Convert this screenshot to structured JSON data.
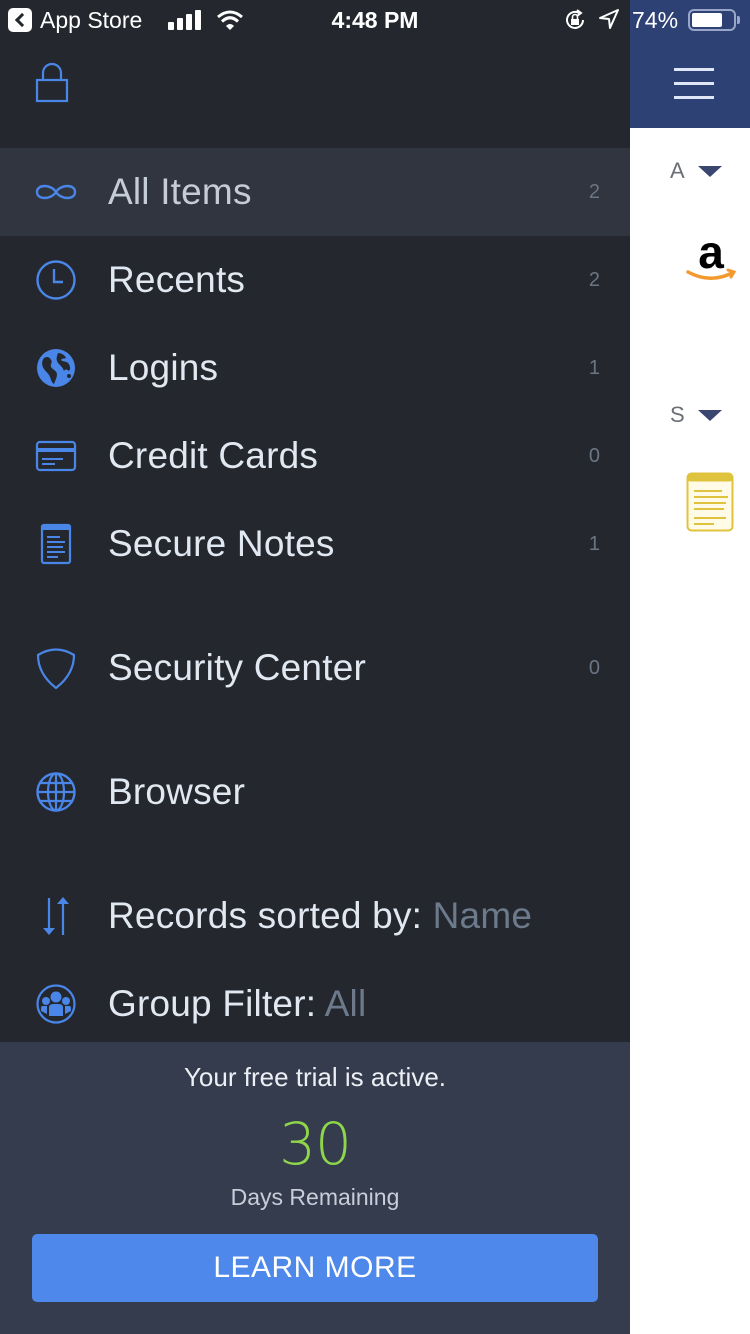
{
  "status_bar": {
    "back_label": "App Store",
    "time": "4:48 PM",
    "battery_percent_label": "74%",
    "battery_level": 0.74
  },
  "sidebar": {
    "lock_icon": "lock-icon",
    "items": [
      {
        "label": "All Items",
        "count": "2",
        "icon": "infinity-icon",
        "active": true
      },
      {
        "label": "Recents",
        "count": "2",
        "icon": "clock-icon"
      },
      {
        "label": "Logins",
        "count": "1",
        "icon": "globe-earth-icon"
      },
      {
        "label": "Credit Cards",
        "count": "0",
        "icon": "credit-card-icon"
      },
      {
        "label": "Secure Notes",
        "count": "1",
        "icon": "note-icon"
      },
      {
        "label": "Security Center",
        "count": "0",
        "icon": "shield-icon"
      },
      {
        "label": "Browser",
        "icon": "globe-grid-icon"
      }
    ],
    "sort": {
      "label": "Records sorted by:",
      "value": "Name",
      "icon": "sort-arrows-icon"
    },
    "group_filter": {
      "label": "Group Filter:",
      "value": "All",
      "icon": "group-icon"
    }
  },
  "trial": {
    "message": "Your free trial is active.",
    "days": "30",
    "days_label": "Days Remaining",
    "button_label": "LEARN MORE"
  },
  "main": {
    "sections": [
      {
        "letter": "A",
        "records": [
          {
            "icon": "amazon-logo-icon"
          }
        ]
      },
      {
        "letter": "S",
        "records": [
          {
            "icon": "secure-note-icon"
          }
        ]
      }
    ]
  },
  "colors": {
    "accent": "#4d88ea",
    "sidebar_bg": "#24282e",
    "active_row": "#31353f",
    "trial_bg": "#343c4e",
    "days_green": "#8fd64a",
    "header_navy": "#2e4175"
  }
}
